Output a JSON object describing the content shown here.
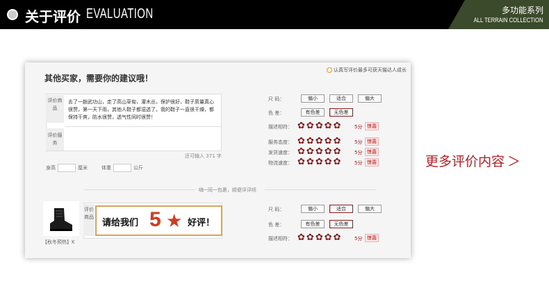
{
  "header": {
    "title_cn": "关于评价",
    "title_en": "EVALUATION",
    "badge_cn": "多功能系列",
    "badge_en": "ALL TERRAIN COLLECTION"
  },
  "panel": {
    "heading": "其他买家，需要你的建议哦！",
    "hint": "认真写评价最多可获天猫达人成长",
    "review_label": "评价商品",
    "service_label": "评价服务",
    "review_text": "去了一趟武功山，走了高山草甸，灌木丛，保护很好，鞋子质量真心很赞，第一天下雨，其他人鞋子都湿透了，我的鞋子一直很干燥，都保持干爽，防水很赞，透气性同时很赞！",
    "char_limit": "还可输入 371 字",
    "height_label": "身高",
    "height_unit": "厘米",
    "weight_label": "体重",
    "weight_unit": "公斤",
    "attrs": {
      "size_label": "尺    码：",
      "size_options": [
        "偏小",
        "适合",
        "偏大"
      ],
      "color_label": "色    差：",
      "color_options": [
        "有色差",
        "无色差"
      ],
      "desc_label": "描述相符：",
      "service_label": "服务态度：",
      "ship_label": "发货速度：",
      "logistics_label": "物流速度：",
      "score": "5分",
      "tag": "惊喜"
    },
    "divider": "嗨~同一包裹，顺便评评呗",
    "product_name": "【秋冬预热】K",
    "review2_label": "评价商品",
    "banner_pre": "请给我们",
    "banner_num": "5",
    "banner_post": "好评！"
  },
  "more_link": "更多评价内容",
  "colors": {
    "accent": "#8b1a1a",
    "link": "#c01c22",
    "badge": "#3b4a2a"
  }
}
